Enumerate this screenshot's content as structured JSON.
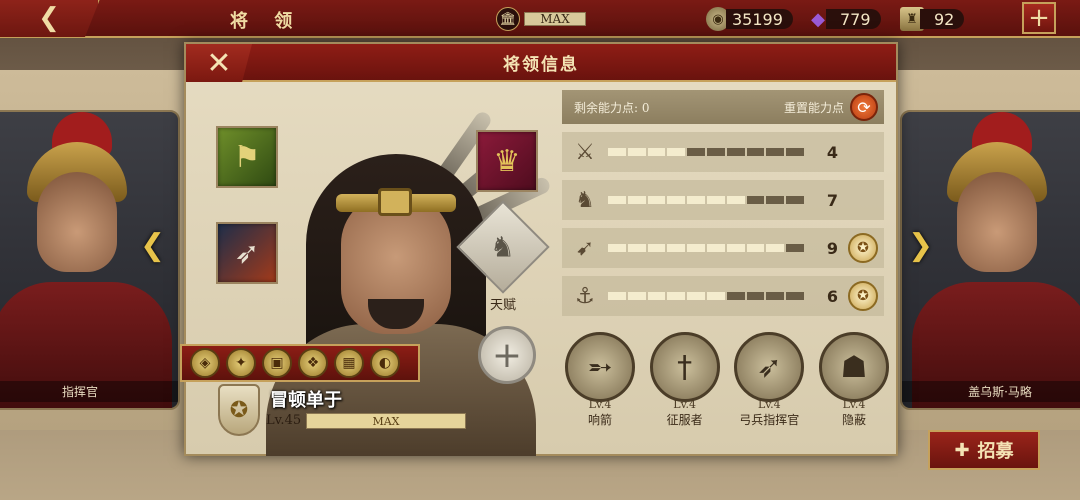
{
  "topbar": {
    "title": "将 领",
    "back_icon": "back-arrow-icon",
    "capacity_label": "MAX",
    "coins": "35199",
    "gems": "779",
    "troops": "92",
    "plus_icon": "plus-icon"
  },
  "modal": {
    "title": "将领信息",
    "close_icon": "close-icon"
  },
  "hero": {
    "name": "冒顿单于",
    "level": "Lv.45",
    "level_bar_label": "MAX",
    "talent_label": "天赋"
  },
  "stats": {
    "remaining_label": "剩余能力点: 0",
    "reset_label": "重置能力点",
    "rows": [
      {
        "icon": "sword-icon",
        "value": "4",
        "filled": 4,
        "total": 10,
        "badge": false
      },
      {
        "icon": "horse-icon",
        "value": "7",
        "filled": 7,
        "total": 10,
        "badge": false
      },
      {
        "icon": "bow-icon",
        "value": "9",
        "filled": 9,
        "total": 10,
        "badge": true
      },
      {
        "icon": "anchor-icon",
        "value": "6",
        "filled": 6,
        "total": 10,
        "badge": true
      }
    ]
  },
  "skills": [
    {
      "icon": "whistling-arrow-icon",
      "level": "Lv.4",
      "name": "响箭"
    },
    {
      "icon": "conqueror-sword-icon",
      "level": "Lv.4",
      "name": "征服者"
    },
    {
      "icon": "archer-commander-icon",
      "level": "Lv.4",
      "name": "弓兵指挥官"
    },
    {
      "icon": "stealth-icon",
      "level": "Lv.4",
      "name": "隐蔽"
    }
  ],
  "background_cards": {
    "left_name": "指挥官",
    "right_name": "盖乌斯·马略"
  },
  "recruit": {
    "label": "招募"
  },
  "colors": {
    "header_red": "#7a1a14",
    "gold_border": "#c6a15b",
    "parchment": "#e6dcc2"
  }
}
